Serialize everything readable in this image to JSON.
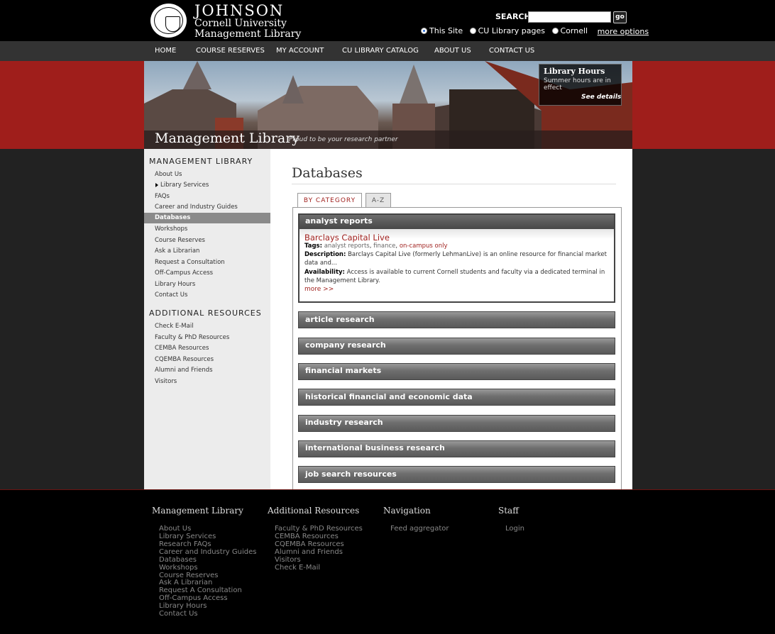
{
  "header": {
    "logo_big": "JOHNSON",
    "logo_line2": "Cornell University",
    "logo_line3": "Management Library",
    "search_label": "SEARCH:",
    "search_value": "",
    "go_label": "go",
    "radios": [
      {
        "label": "This Site",
        "selected": true
      },
      {
        "label": "CU Library pages",
        "selected": false
      },
      {
        "label": "Cornell",
        "selected": false
      }
    ],
    "more_options": "more options"
  },
  "nav": [
    "HOME",
    "COURSE RESERVES",
    "MY ACCOUNT",
    "CU LIBRARY CATALOG",
    "ABOUT US",
    "CONTACT US"
  ],
  "banner": {
    "title": "Management Library",
    "tagline": "Proud to be your research partner",
    "hours_title": "Library Hours",
    "hours_text": "Summer hours are in effect",
    "hours_link": "See details"
  },
  "sidebar": {
    "heading1": "MANAGEMENT LIBRARY",
    "items1": [
      "About Us",
      "Library Services",
      "FAQs",
      "Career and Industry Guides",
      "Databases",
      "Workshops",
      "Course Reserves",
      "Ask a Librarian",
      "Request a Consultation",
      "Off-Campus Access",
      "Library Hours",
      "Contact Us"
    ],
    "active_item": "Databases",
    "heading2": "ADDITIONAL RESOURCES",
    "items2": [
      "Check E-Mail",
      "Faculty & PhD Resources",
      "CEMBA Resources",
      "CQEMBA Resources",
      "Alumni and Friends",
      "Visitors"
    ]
  },
  "main": {
    "title": "Databases",
    "tabs": [
      "BY CATEGORY",
      "A-Z"
    ],
    "open_category": "analyst reports",
    "db": {
      "title": "Barclays Capital Live",
      "tags_label": "Tags:",
      "tag1": "analyst reports",
      "tag2": "finance",
      "tag3": "on-campus only",
      "desc_label": "Description:",
      "desc_text": "Barclays Capital Live (formerly LehmanLive) is an online resource for financial market data and...",
      "avail_label": "Availability:",
      "avail_text": "Access is available to current Cornell students and faculty via a dedicated terminal in the Management Library.",
      "more": "more >>"
    },
    "categories": [
      "article research",
      "company research",
      "financial markets",
      "historical financial and economic data",
      "industry research",
      "international business research",
      "job search resources"
    ]
  },
  "footer": {
    "col1_title": "Management Library",
    "col1": [
      "About Us",
      "Library Services",
      "Research FAQs",
      "Career and Industry Guides",
      "Databases",
      "Workshops",
      "Course Reserves",
      "Ask A Librarian",
      "Request A Consultation",
      "Off-Campus Access",
      "Library Hours",
      "Contact Us"
    ],
    "col2_title": "Additional Resources",
    "col2": [
      "Faculty & PhD Resources",
      "CEMBA Resources",
      "CQEMBA Resources",
      "Alumni and Friends",
      "Visitors",
      "Check E-Mail"
    ],
    "col3_title": "Navigation",
    "col3": [
      "Feed aggregator"
    ],
    "col4_title": "Staff",
    "col4": [
      "Login"
    ]
  }
}
